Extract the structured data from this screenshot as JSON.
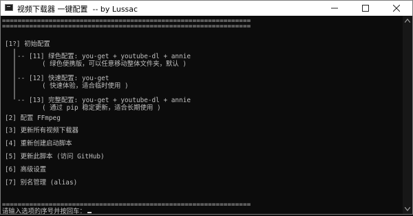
{
  "window": {
    "title": "视频下载器 一键配置  -- by Lussac",
    "minimize_label": "—",
    "maximize_label": "☐",
    "close_label": "✕"
  },
  "console": {
    "separator_top_1": "================================================================",
    "separator_top_2": "================================================================",
    "menu_initial": "[1?] 初始配置",
    "opt11_title": "-- [11] 绿色配置: you-get + youtube-dl + annie",
    "opt11_desc": "( 绿色便携版，可以任意移动整体文件夹，默认 )",
    "opt12_title": "-- [12] 快速配置: you-get",
    "opt12_desc": "( 快速体验，适合临时使用 )",
    "opt13_title": "-- [13] 完整配置: you-get + youtube-dl + annie",
    "opt13_desc": "( 通过 pip 稳定更新，适合长期使用 )",
    "menu_2": "[2] 配置 FFmpeg",
    "menu_3": "[3] 更新所有视频下载器",
    "menu_4": "[4] 重新创建启动脚本",
    "menu_5": "[5] 更新此脚本 (访问 GitHub)",
    "menu_6": "[6] 高级设置",
    "menu_7": "[7] 别名管理 (alias)",
    "separator_bottom": "================================================================",
    "prompt": "请输入选项的序号并按回车："
  }
}
